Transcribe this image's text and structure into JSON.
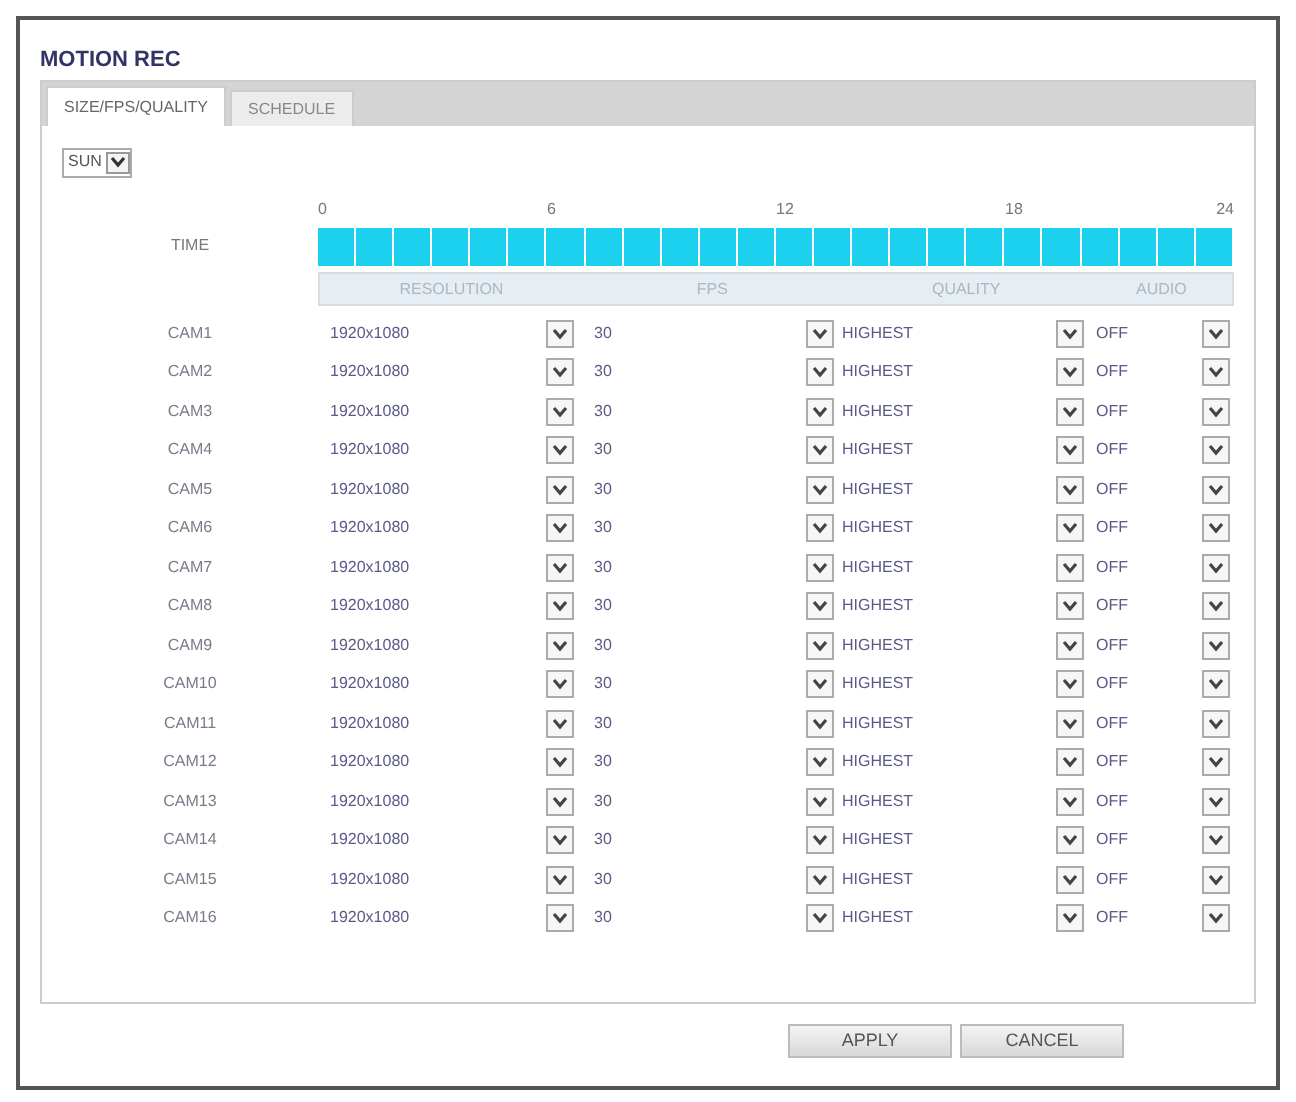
{
  "title": "MOTION REC",
  "tabs": [
    {
      "label": "SIZE/FPS/QUALITY",
      "selected": true
    },
    {
      "label": "SCHEDULE",
      "selected": false
    }
  ],
  "day": {
    "value": "SUN"
  },
  "time": {
    "label": "TIME",
    "ticks": [
      "0",
      "6",
      "12",
      "18",
      "24"
    ],
    "slots": [
      {
        "selected": true
      },
      {
        "selected": true
      },
      {
        "selected": true
      },
      {
        "selected": true
      },
      {
        "selected": true
      },
      {
        "selected": true
      },
      {
        "selected": true
      },
      {
        "selected": true
      },
      {
        "selected": true
      },
      {
        "selected": true
      },
      {
        "selected": true
      },
      {
        "selected": true
      },
      {
        "selected": true
      },
      {
        "selected": true
      },
      {
        "selected": true
      },
      {
        "selected": true
      },
      {
        "selected": true
      },
      {
        "selected": true
      },
      {
        "selected": true
      },
      {
        "selected": true
      },
      {
        "selected": true
      },
      {
        "selected": true
      },
      {
        "selected": true
      },
      {
        "selected": true
      }
    ]
  },
  "columns": [
    "RESOLUTION",
    "FPS",
    "QUALITY",
    "AUDIO"
  ],
  "rows": [
    {
      "camera": "CAM1",
      "resolution": "1920x1080",
      "fps": "30",
      "quality": "HIGHEST",
      "audio": "OFF"
    },
    {
      "camera": "CAM2",
      "resolution": "1920x1080",
      "fps": "30",
      "quality": "HIGHEST",
      "audio": "OFF"
    },
    {
      "camera": "CAM3",
      "resolution": "1920x1080",
      "fps": "30",
      "quality": "HIGHEST",
      "audio": "OFF"
    },
    {
      "camera": "CAM4",
      "resolution": "1920x1080",
      "fps": "30",
      "quality": "HIGHEST",
      "audio": "OFF"
    },
    {
      "camera": "CAM5",
      "resolution": "1920x1080",
      "fps": "30",
      "quality": "HIGHEST",
      "audio": "OFF"
    },
    {
      "camera": "CAM6",
      "resolution": "1920x1080",
      "fps": "30",
      "quality": "HIGHEST",
      "audio": "OFF"
    },
    {
      "camera": "CAM7",
      "resolution": "1920x1080",
      "fps": "30",
      "quality": "HIGHEST",
      "audio": "OFF"
    },
    {
      "camera": "CAM8",
      "resolution": "1920x1080",
      "fps": "30",
      "quality": "HIGHEST",
      "audio": "OFF"
    },
    {
      "camera": "CAM9",
      "resolution": "1920x1080",
      "fps": "30",
      "quality": "HIGHEST",
      "audio": "OFF"
    },
    {
      "camera": "CAM10",
      "resolution": "1920x1080",
      "fps": "30",
      "quality": "HIGHEST",
      "audio": "OFF"
    },
    {
      "camera": "CAM11",
      "resolution": "1920x1080",
      "fps": "30",
      "quality": "HIGHEST",
      "audio": "OFF"
    },
    {
      "camera": "CAM12",
      "resolution": "1920x1080",
      "fps": "30",
      "quality": "HIGHEST",
      "audio": "OFF"
    },
    {
      "camera": "CAM13",
      "resolution": "1920x1080",
      "fps": "30",
      "quality": "HIGHEST",
      "audio": "OFF"
    },
    {
      "camera": "CAM14",
      "resolution": "1920x1080",
      "fps": "30",
      "quality": "HIGHEST",
      "audio": "OFF"
    },
    {
      "camera": "CAM15",
      "resolution": "1920x1080",
      "fps": "30",
      "quality": "HIGHEST",
      "audio": "OFF"
    },
    {
      "camera": "CAM16",
      "resolution": "1920x1080",
      "fps": "30",
      "quality": "HIGHEST",
      "audio": "OFF"
    }
  ],
  "buttons": [
    "APPLY",
    "CANCEL"
  ]
}
